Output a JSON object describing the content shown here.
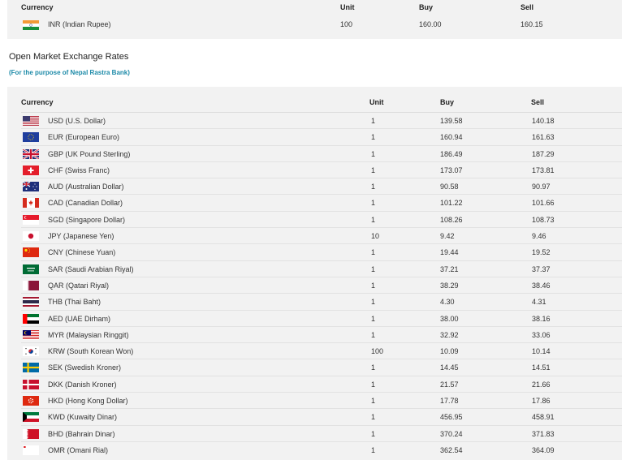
{
  "top_table": {
    "headers": {
      "currency": "Currency",
      "unit": "Unit",
      "buy": "Buy",
      "sell": "Sell"
    },
    "row": {
      "flag": "india-flag-icon",
      "name": "INR (Indian Rupee)",
      "unit": "100",
      "buy": "160.00",
      "sell": "160.15"
    }
  },
  "section": {
    "title": "Open Market Exchange Rates",
    "subtitle": "(For the purpose of Nepal Rastra Bank)"
  },
  "main_table": {
    "headers": {
      "currency": "Currency",
      "unit": "Unit",
      "buy": "Buy",
      "sell": "Sell"
    },
    "rows": [
      {
        "flag": "usa-flag-icon",
        "name": "USD (U.S. Dollar)",
        "unit": "1",
        "buy": "139.58",
        "sell": "140.18"
      },
      {
        "flag": "eu-flag-icon",
        "name": "EUR (European Euro)",
        "unit": "1",
        "buy": "160.94",
        "sell": "161.63"
      },
      {
        "flag": "uk-flag-icon",
        "name": "GBP (UK Pound Sterling)",
        "unit": "1",
        "buy": "186.49",
        "sell": "187.29"
      },
      {
        "flag": "swiss-flag-icon",
        "name": "CHF (Swiss Franc)",
        "unit": "1",
        "buy": "173.07",
        "sell": "173.81"
      },
      {
        "flag": "australia-flag-icon",
        "name": "AUD (Australian Dollar)",
        "unit": "1",
        "buy": "90.58",
        "sell": "90.97"
      },
      {
        "flag": "canada-flag-icon",
        "name": "CAD (Canadian Dollar)",
        "unit": "1",
        "buy": "101.22",
        "sell": "101.66"
      },
      {
        "flag": "singapore-flag-icon",
        "name": "SGD (Singapore Dollar)",
        "unit": "1",
        "buy": "108.26",
        "sell": "108.73"
      },
      {
        "flag": "japan-flag-icon",
        "name": "JPY (Japanese Yen)",
        "unit": "10",
        "buy": "9.42",
        "sell": "9.46"
      },
      {
        "flag": "china-flag-icon",
        "name": "CNY (Chinese Yuan)",
        "unit": "1",
        "buy": "19.44",
        "sell": "19.52"
      },
      {
        "flag": "saudi-flag-icon",
        "name": "SAR (Saudi Arabian Riyal)",
        "unit": "1",
        "buy": "37.21",
        "sell": "37.37"
      },
      {
        "flag": "qatar-flag-icon",
        "name": "QAR (Qatari Riyal)",
        "unit": "1",
        "buy": "38.29",
        "sell": "38.46"
      },
      {
        "flag": "thailand-flag-icon",
        "name": "THB (Thai Baht)",
        "unit": "1",
        "buy": "4.30",
        "sell": "4.31"
      },
      {
        "flag": "uae-flag-icon",
        "name": "AED (UAE Dirham)",
        "unit": "1",
        "buy": "38.00",
        "sell": "38.16"
      },
      {
        "flag": "malaysia-flag-icon",
        "name": "MYR (Malaysian Ringgit)",
        "unit": "1",
        "buy": "32.92",
        "sell": "33.06"
      },
      {
        "flag": "korea-flag-icon",
        "name": "KRW (South Korean Won)",
        "unit": "100",
        "buy": "10.09",
        "sell": "10.14"
      },
      {
        "flag": "sweden-flag-icon",
        "name": "SEK (Swedish Kroner)",
        "unit": "1",
        "buy": "14.45",
        "sell": "14.51"
      },
      {
        "flag": "denmark-flag-icon",
        "name": "DKK (Danish Kroner)",
        "unit": "1",
        "buy": "21.57",
        "sell": "21.66"
      },
      {
        "flag": "hongkong-flag-icon",
        "name": "HKD (Hong Kong Dollar)",
        "unit": "1",
        "buy": "17.78",
        "sell": "17.86"
      },
      {
        "flag": "kuwait-flag-icon",
        "name": "KWD (Kuwaity Dinar)",
        "unit": "1",
        "buy": "456.95",
        "sell": "458.91"
      },
      {
        "flag": "bahrain-flag-icon",
        "name": "BHD (Bahrain Dinar)",
        "unit": "1",
        "buy": "370.24",
        "sell": "371.83"
      },
      {
        "flag": "oman-flag-icon",
        "name": "OMR (Omani Rial)",
        "unit": "1",
        "buy": "362.54",
        "sell": "364.09"
      }
    ]
  },
  "colors": {
    "panel_bg": "#f2f2f2",
    "subtitle": "#1c8aa8",
    "row_border": "#e2e2e2"
  }
}
